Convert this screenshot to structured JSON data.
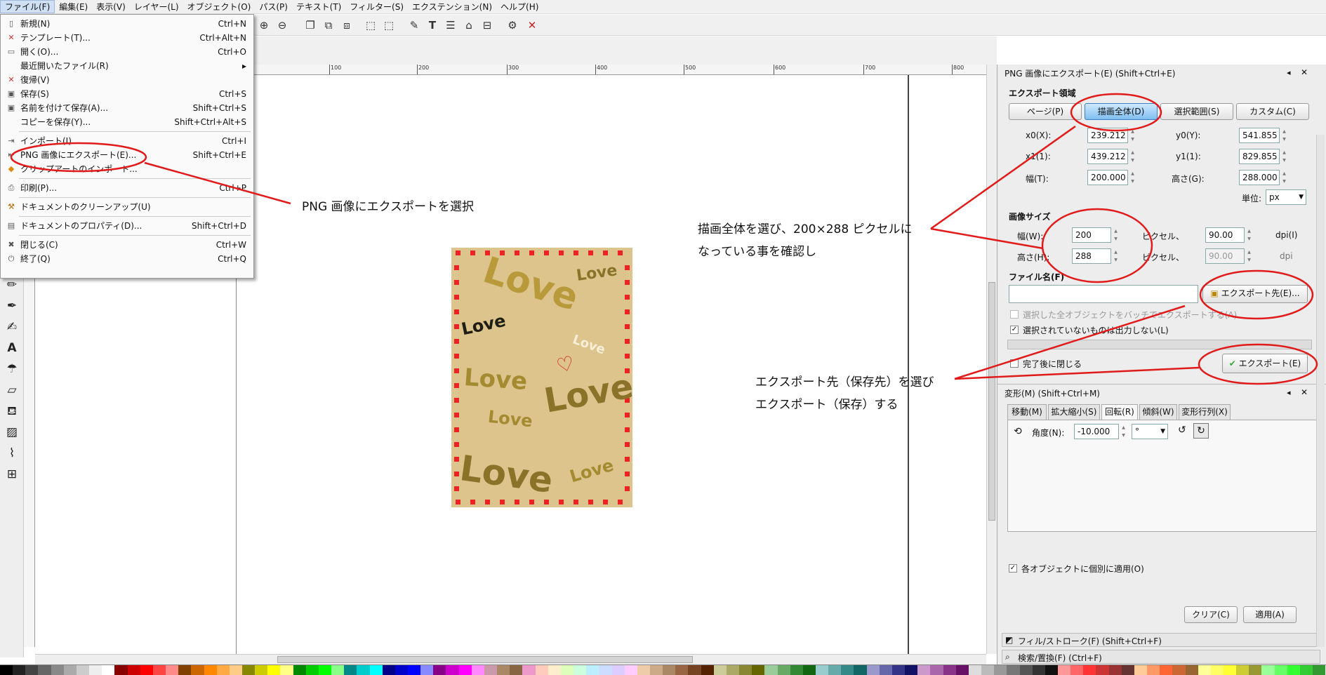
{
  "menubar": {
    "items": [
      "ファイル(F)",
      "編集(E)",
      "表示(V)",
      "レイヤー(L)",
      "オブジェクト(O)",
      "パス(P)",
      "テキスト(T)",
      "フィルター(S)",
      "エクステンション(N)",
      "ヘルプ(H)"
    ]
  },
  "file_menu": {
    "items": [
      {
        "label": "新規(N)",
        "shortcut": "Ctrl+N"
      },
      {
        "label": "テンプレート(T)...",
        "shortcut": "Ctrl+Alt+N"
      },
      {
        "label": "開く(O)...",
        "shortcut": "Ctrl+O"
      },
      {
        "label": "最近開いたファイル(R)",
        "shortcut": "▸"
      },
      {
        "label": "復帰(V)",
        "shortcut": ""
      },
      {
        "label": "保存(S)",
        "shortcut": "Ctrl+S"
      },
      {
        "label": "名前を付けて保存(A)...",
        "shortcut": "Shift+Ctrl+S"
      },
      {
        "label": "コピーを保存(Y)...",
        "shortcut": "Shift+Ctrl+Alt+S"
      },
      {
        "label": "インポート(I)...",
        "shortcut": "Ctrl+I"
      },
      {
        "label": "PNG 画像にエクスポート(E)...",
        "shortcut": "Shift+Ctrl+E"
      },
      {
        "label": "クリップアートのインポート...",
        "shortcut": ""
      },
      {
        "label": "印刷(P)...",
        "shortcut": "Ctrl+P"
      },
      {
        "label": "ドキュメントのクリーンアップ(U)",
        "shortcut": ""
      },
      {
        "label": "ドキュメントのプロパティ(D)...",
        "shortcut": "Shift+Ctrl+D"
      },
      {
        "label": "閉じる(C)",
        "shortcut": "Ctrl+W"
      },
      {
        "label": "終了(Q)",
        "shortcut": "Ctrl+Q"
      }
    ]
  },
  "ruler": {
    "ticks": [
      "100",
      "200",
      "300",
      "400",
      "500",
      "600",
      "700",
      "800"
    ]
  },
  "page": {
    "word": "Love"
  },
  "export_panel": {
    "title": "PNG 画像にエクスポート(E) (Shift+Ctrl+E)",
    "area_label": "エクスポート領域",
    "buttons": [
      "ページ(P)",
      "描画全体(D)",
      "選択範囲(S)",
      "カスタム(C)"
    ],
    "x0_label": "x0(X):",
    "x0": "239.212",
    "y0_label": "y0(Y):",
    "y0": "541.855",
    "x1_label": "x1(1):",
    "x1": "439.212",
    "y1_label": "y1(1):",
    "y1": "829.855",
    "width_label": "幅(T):",
    "width": "200.000",
    "height_label": "高さ(G):",
    "height": "288.000",
    "unit_label": "単位:",
    "unit": "px",
    "image_size_label": "画像サイズ",
    "img_width_label": "幅(W):",
    "img_width": "200",
    "img_height_label": "高さ(H):",
    "img_height": "288",
    "pixel_label": "ピクセル、",
    "dpi_value": "90.00",
    "dpi_value2": "90.00",
    "dpi_label": "dpi(I)",
    "dpi_label2": "dpi",
    "filename_label": "ファイル名(F)",
    "export_to_button": "エクスポート先(E)...",
    "batch_label": "選択した全オブジェクトをバッチでエクスポートする(A)",
    "hide_label": "選択されていないものは出力しない(L)",
    "close_label": "完了後に閉じる",
    "export_button": "エクスポート(E)"
  },
  "transform_panel": {
    "title": "変形(M) (Shift+Ctrl+M)",
    "tabs": [
      "移動(M)",
      "拡大縮小(S)",
      "回転(R)",
      "傾斜(W)",
      "変形行列(X)"
    ],
    "angle_label": "角度(N):",
    "angle": "-10.000",
    "angle_unit": "°",
    "apply_each_label": "各オブジェクトに個別に適用(O)",
    "clear_button": "クリア(C)",
    "apply_button": "適用(A)"
  },
  "collapsed_panels": {
    "fill_stroke": "フィル/ストローク(F) (Shift+Ctrl+F)",
    "find": "検索/置換(F) (Ctrl+F)"
  },
  "annotations": {
    "note1": "PNG 画像にエクスポートを選択",
    "note2_line1": "描画全体を選び、200×288 ピクセルに",
    "note2_line2": "なっている事を確認し",
    "note3_line1": "エクスポート先（保存先）を選び",
    "note3_line2": "エクスポート（保存）する"
  },
  "colors": {
    "accent": "#e11a1a",
    "page_bg": "#dcc48c",
    "selected_button": "#7fbef0"
  }
}
